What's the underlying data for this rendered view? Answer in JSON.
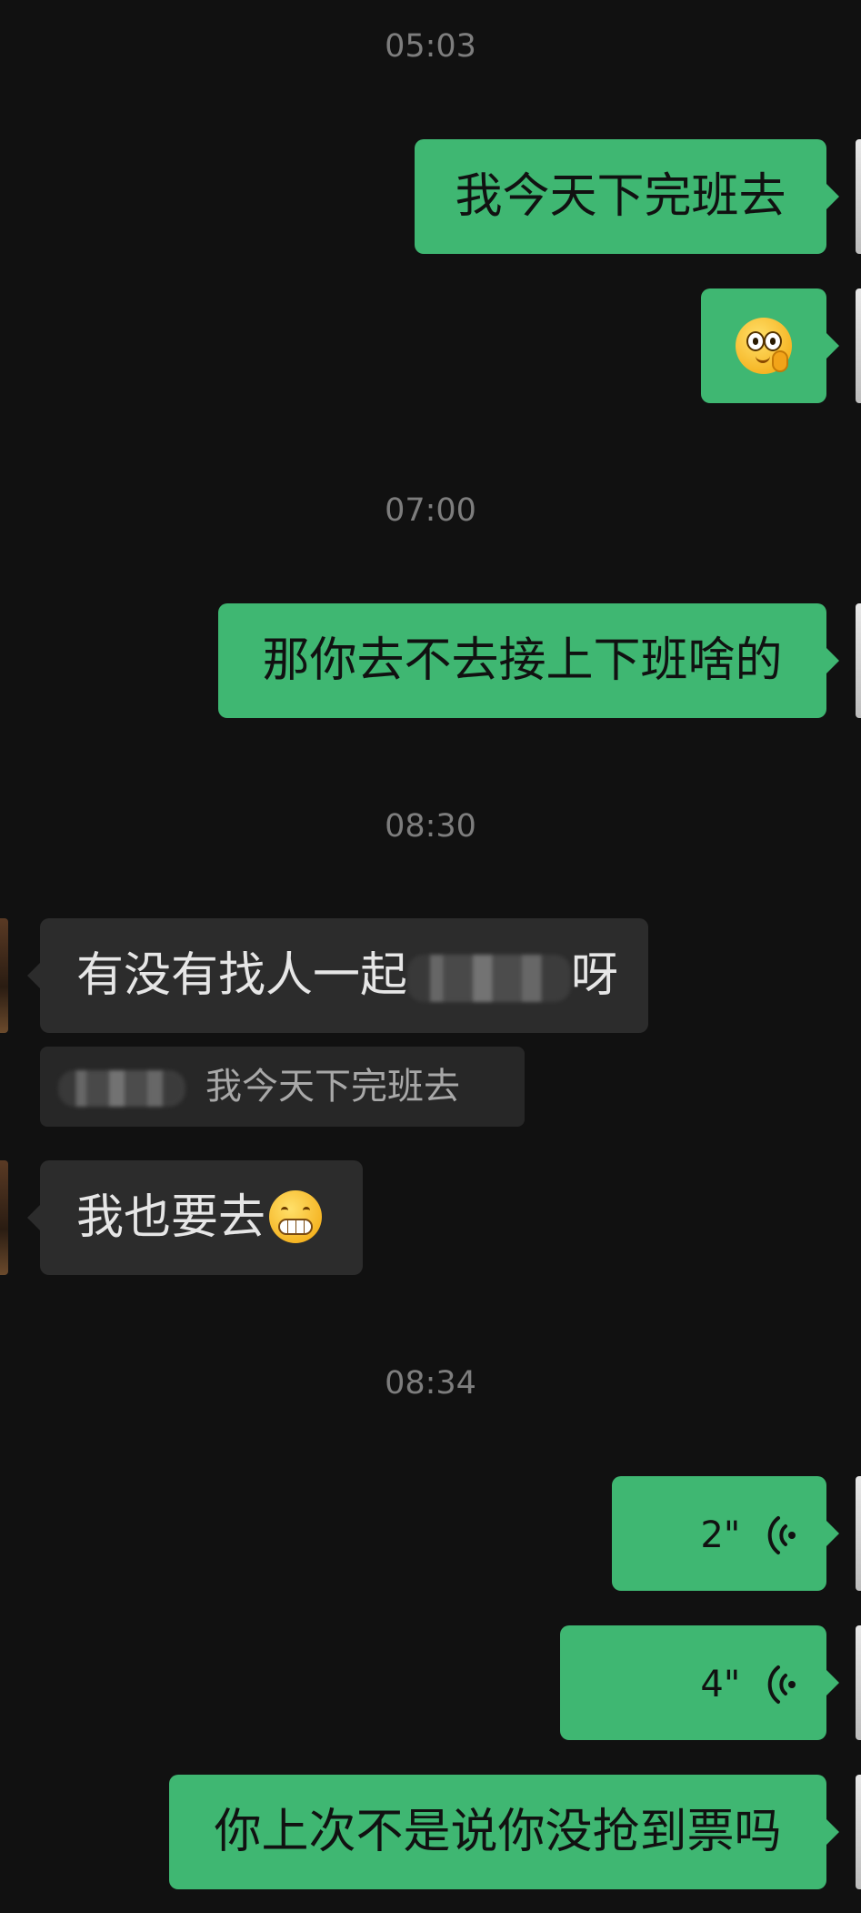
{
  "chat": {
    "timestamps": [
      "05:03",
      "07:00",
      "08:30",
      "08:34"
    ],
    "messages": {
      "m1": "我今天下完班去",
      "m3": "那你去不去接上下班啥的",
      "m4_start": "有没有找人一起",
      "m4_end": "呀",
      "quote_text": "我今天下完班去",
      "m5": "我也要去",
      "v1_duration": "2\"",
      "v2_duration": "4\"",
      "m6": "你上次不是说你没抢到票吗"
    },
    "icons": {
      "m2_emoji": "thinking-face-emoji",
      "m5_emoji": "grimacing-face-emoji",
      "voice": "voice-wave-icon"
    },
    "colors": {
      "background": "#111111",
      "sent_bubble": "#3fb772",
      "received_bubble": "#2c2c2c",
      "timestamp": "#7d7d7d"
    }
  }
}
